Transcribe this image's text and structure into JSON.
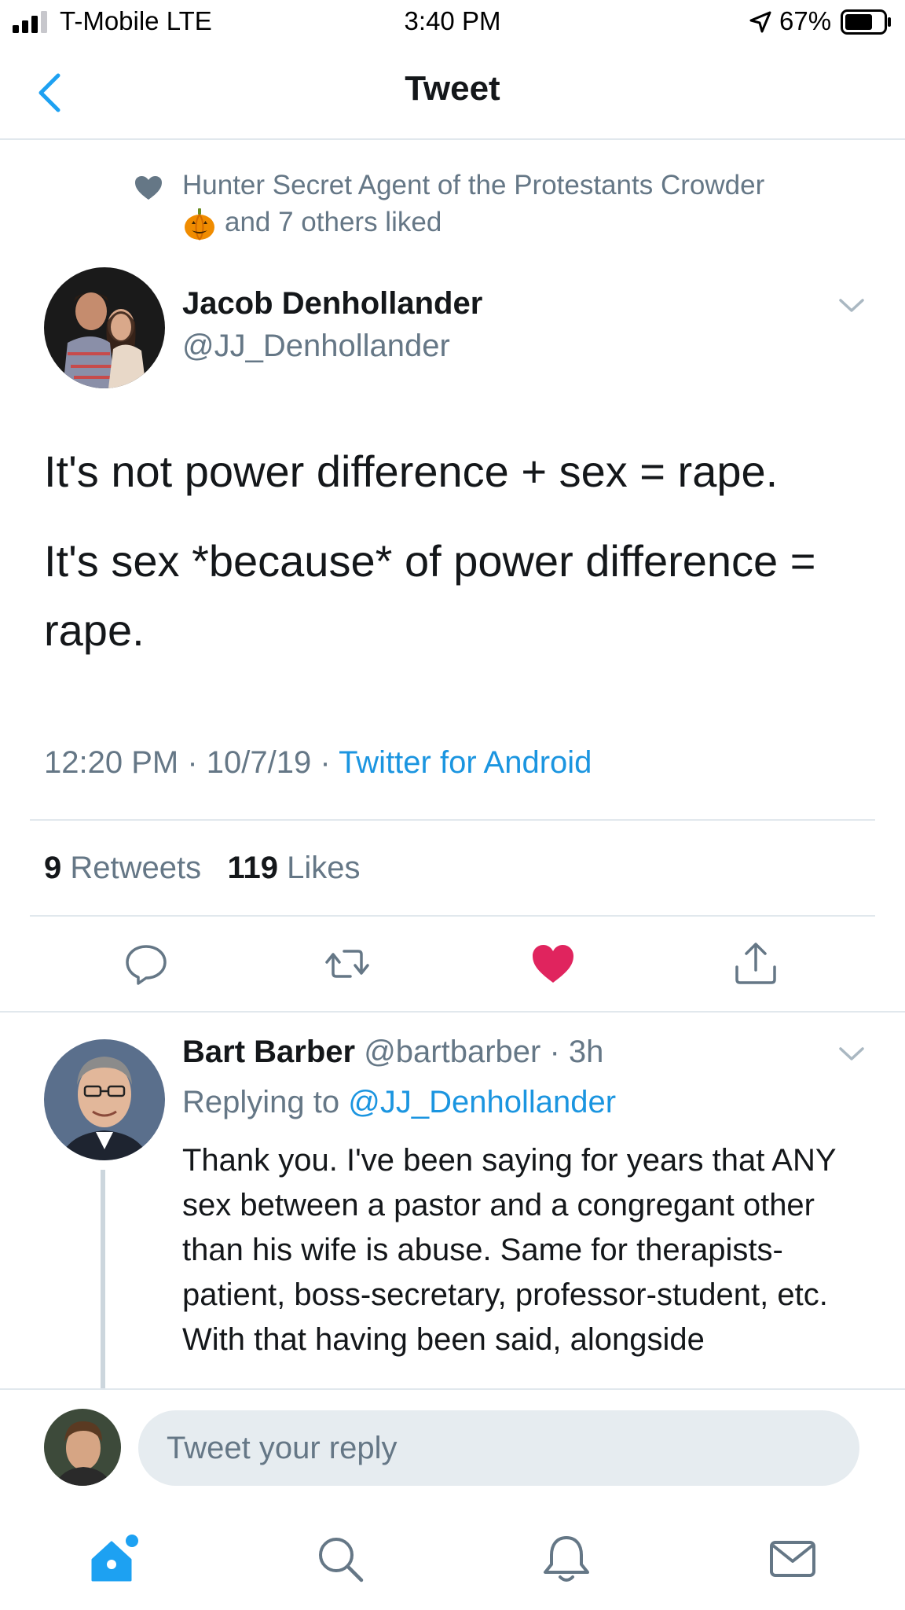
{
  "status_bar": {
    "carrier": "T-Mobile LTE",
    "time": "3:40 PM",
    "battery": "67%",
    "icons": [
      "signal-icon",
      "location-arrow-icon",
      "battery-icon"
    ]
  },
  "header": {
    "title": "Tweet",
    "back_icon": "chevron-left-icon"
  },
  "social_context": {
    "icon": "heart-icon",
    "text_line1": "Hunter Secret Agent of the Protestants Crowder",
    "emoji": "pumpkin-icon",
    "text_line2": "and 7 others liked"
  },
  "tweet": {
    "author_name": "Jacob Denhollander",
    "author_handle": "@JJ_Denhollander",
    "paragraph1": "It's not power difference + sex = rape.",
    "paragraph2": "It's sex *because* of power difference = rape.",
    "time": "12:20 PM",
    "date": "10/7/19",
    "source": "Twitter for Android",
    "retweets_count": "9",
    "retweets_label": "Retweets",
    "likes_count": "119",
    "likes_label": "Likes"
  },
  "actions": [
    "reply-icon",
    "retweet-icon",
    "liked-heart-icon",
    "share-icon"
  ],
  "reply": {
    "author_name": "Bart Barber",
    "author_handle": "@bartbarber",
    "age": "3h",
    "replying_to_label": "Replying to",
    "replying_to_handle": "@JJ_Denhollander",
    "text": "Thank you. I've been saying for years that ANY sex between a pastor and a congregant other than his wife is abuse. Same for therapists-patient, boss-secretary, professor-student, etc. With that having been said, alongside"
  },
  "compose": {
    "placeholder": "Tweet your reply"
  },
  "tabs": [
    "home-icon",
    "search-icon",
    "notifications-icon",
    "messages-icon"
  ],
  "colors": {
    "accent": "#1da1f2",
    "link": "#1b95e0",
    "like": "#e0245e",
    "secondary_text": "#657786",
    "divider": "#e1e8ed"
  }
}
